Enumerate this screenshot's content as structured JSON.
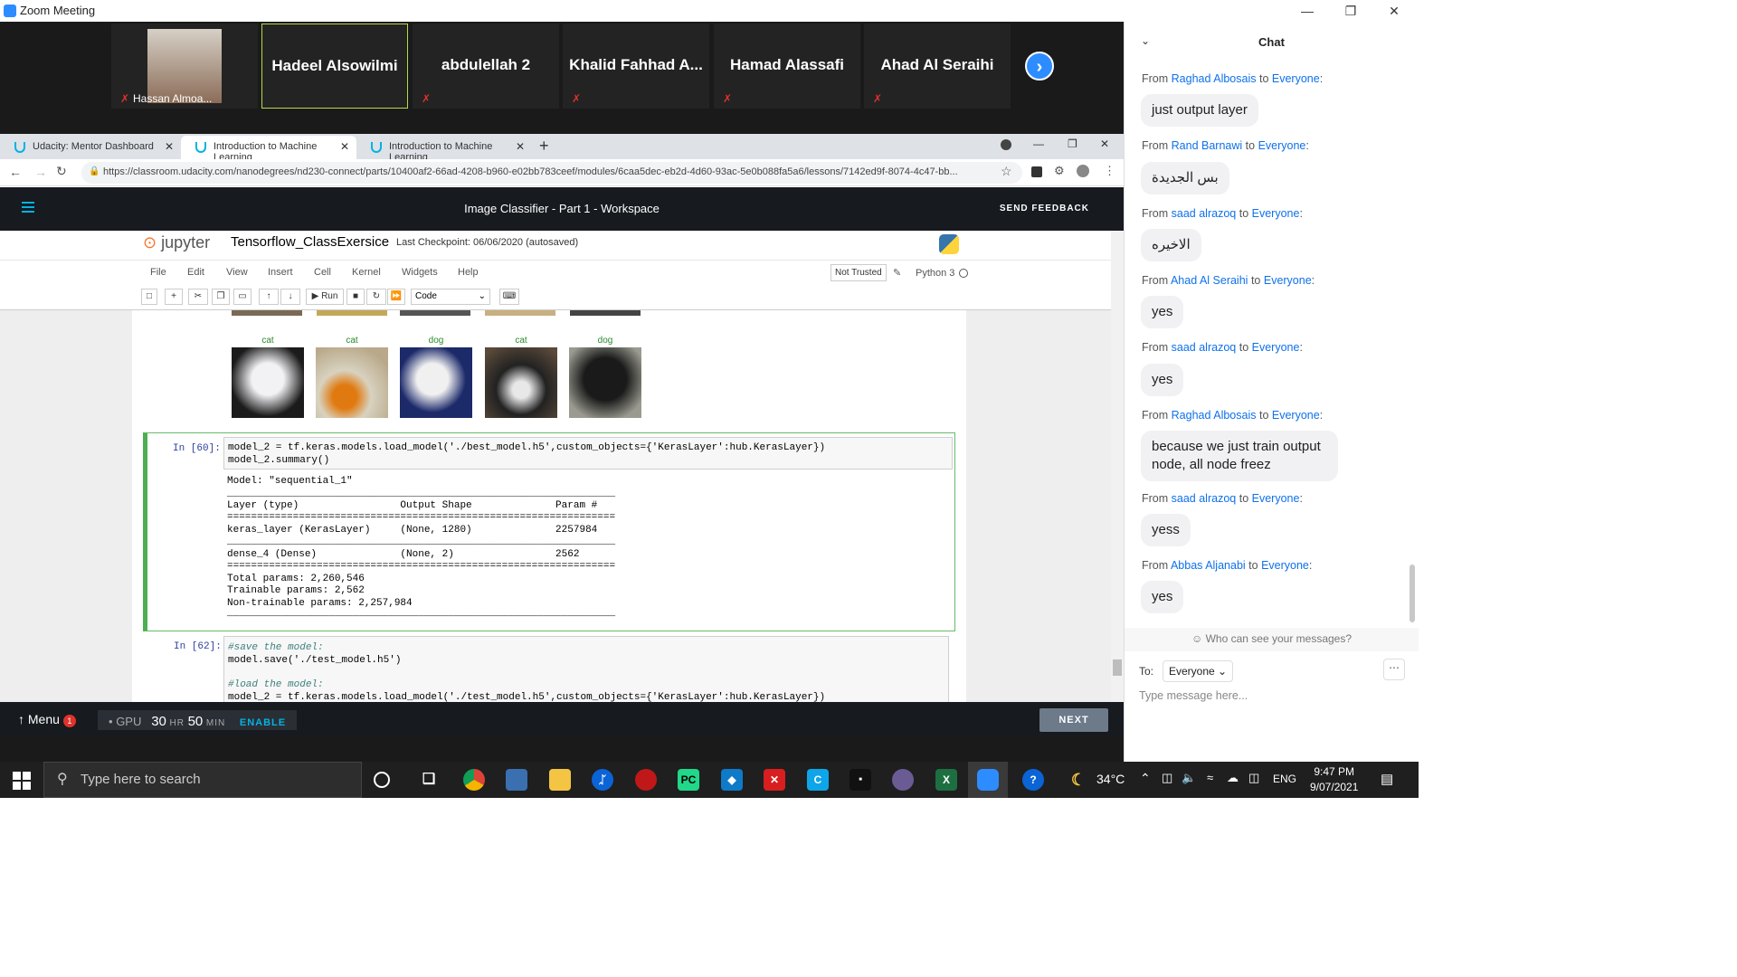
{
  "zoom": {
    "window_title": "Zoom Meeting",
    "participants": [
      {
        "name": "Hassan Almoa..."
      },
      {
        "name": "Hadeel Alsowilmi"
      },
      {
        "name": "abdulellah 2"
      },
      {
        "name": "Khalid  Fahhad  A..."
      },
      {
        "name": "Hamad Alassafi"
      },
      {
        "name": "Ahad Al Seraihi"
      }
    ]
  },
  "browser": {
    "tabs": [
      {
        "label": "Udacity: Mentor Dashboard"
      },
      {
        "label": "Introduction to Machine Learning"
      },
      {
        "label": "Introduction to Machine Learning"
      }
    ],
    "url": "https://classroom.udacity.com/nanodegrees/nd230-connect/parts/10400af2-66ad-4208-b960-e02bb783ceef/modules/6caa5dec-eb2d-4d60-93ac-5e0b088fa5a6/lessons/7142ed9f-8074-4c47-bb..."
  },
  "udacity": {
    "title": "Image Classifier - Part 1 - Workspace",
    "send_feedback": "SEND FEEDBACK",
    "footer": {
      "menu_label": "Menu",
      "menu_badge": "1",
      "gpu_label": "GPU",
      "hours": "30",
      "hr_unit": "HR",
      "minutes": "50",
      "min_unit": "MIN",
      "enable": "ENABLE",
      "next": "NEXT"
    }
  },
  "jupyter": {
    "logo": "jupyter",
    "notebook_name": "Tensorflow_ClassExersice",
    "checkpoint": "Last Checkpoint: 06/06/2020  (autosaved)",
    "menu": [
      "File",
      "Edit",
      "View",
      "Insert",
      "Cell",
      "Kernel",
      "Widgets",
      "Help"
    ],
    "not_trusted": "Not Trusted",
    "kernel": "Python 3",
    "run_label": "Run",
    "cell_type": "Code",
    "thumb_labels": [
      "cat",
      "cat",
      "dog",
      "cat",
      "dog"
    ],
    "cell1_prompt": "In [60]:",
    "cell1_line1": "model_2 = tf.keras.models.load_model('./best_model.h5',custom_objects={'KerasLayer':hub.KerasLayer})",
    "cell1_line2": "model_2.summary()",
    "summary": {
      "model_name": "Model: \"sequential_1\"",
      "sep": "_________________________________________________________________",
      "header": "Layer (type)                 Output Shape              Param #   ",
      "eq": "=================================================================",
      "row1": "keras_layer (KerasLayer)     (None, 1280)              2257984   ",
      "row2": "dense_4 (Dense)              (None, 2)                 2562      ",
      "total": "Total params: 2,260,546",
      "trainable": "Trainable params: 2,562",
      "non_trainable": "Non-trainable params: 2,257,984"
    },
    "cell2_prompt": "In [62]:",
    "cell2_line1": "#save the model:",
    "cell2_line2": "model.save('./test_model.h5')",
    "cell2_line3": "#load the model:",
    "cell2_line4": "model_2 = tf.keras.models.load_model('./test_model.h5',custom_objects={'KerasLayer':hub.KerasLayer})"
  },
  "chat": {
    "title": "Chat",
    "messages": [
      {
        "from": "Raghad Albosais",
        "to": "Everyone",
        "text": "just output layer"
      },
      {
        "from": "Rand Barnawi",
        "to": "Everyone",
        "text": "بس الجديدة"
      },
      {
        "from": "saad alrazoq",
        "to": "Everyone",
        "text": "الاخيره"
      },
      {
        "from": "Ahad Al Seraihi",
        "to": "Everyone",
        "text": "yes"
      },
      {
        "from": "saad alrazoq",
        "to": "Everyone",
        "text": "yes"
      },
      {
        "from": "Raghad Albosais",
        "to": "Everyone",
        "text": "because we just train output node, all node freez"
      },
      {
        "from": "saad alrazoq",
        "to": "Everyone",
        "text": "yess"
      },
      {
        "from": "Abbas Aljanabi",
        "to": "Everyone",
        "text": "yes"
      }
    ],
    "from_word": "From",
    "to_word": "to",
    "who_can_see": "Who can see your messages?",
    "to_label": "To:",
    "to_value": "Everyone",
    "placeholder": "Type message here..."
  },
  "taskbar": {
    "search_placeholder": "Type here to search",
    "temperature": "34°C",
    "language": "ENG",
    "time": "9:47 PM",
    "date": "9/07/2021"
  }
}
